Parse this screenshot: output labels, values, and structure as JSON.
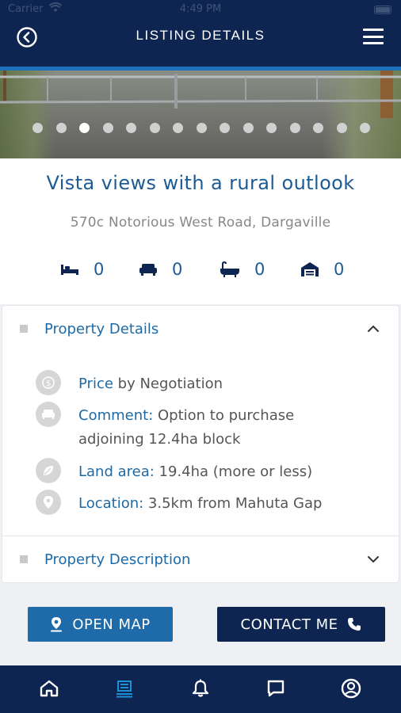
{
  "status_bar": {
    "carrier": "Carrier",
    "time": "4:49 PM"
  },
  "header": {
    "title": "LISTING DETAILS"
  },
  "gallery": {
    "photo_count": 15,
    "active_index": 2
  },
  "listing": {
    "title": "Vista views with a rural outlook",
    "address": "570c Notorious West Road, Dargaville",
    "features": [
      {
        "icon": "bed-icon",
        "value": "0"
      },
      {
        "icon": "sofa-icon",
        "value": "0"
      },
      {
        "icon": "bath-icon",
        "value": "0"
      },
      {
        "icon": "garage-icon",
        "value": "0"
      }
    ]
  },
  "property_details": {
    "heading": "Property Details",
    "price": {
      "label": "Price",
      "value": " by Negotiation"
    },
    "comment": {
      "label": "Comment:",
      "value": " Option to purchase",
      "value_line2": "adjoining 12.4ha block"
    },
    "land_area": {
      "label": "Land area:",
      "value": " 19.4ha (more or less)"
    },
    "location": {
      "label": "Location:",
      "value": " 3.5km from Mahuta Gap"
    }
  },
  "property_description": {
    "heading": "Property Description"
  },
  "actions": {
    "open_map": "OPEN MAP",
    "contact_me": "CONTACT ME"
  },
  "tabbar": {
    "tabs": [
      "home-icon",
      "listings-icon",
      "bell-icon",
      "chat-icon",
      "profile-icon"
    ],
    "active": "listings-icon"
  },
  "colors": {
    "navy": "#0d2550",
    "accent_blue": "#1f6aa8",
    "title_blue": "#1d5b94"
  }
}
